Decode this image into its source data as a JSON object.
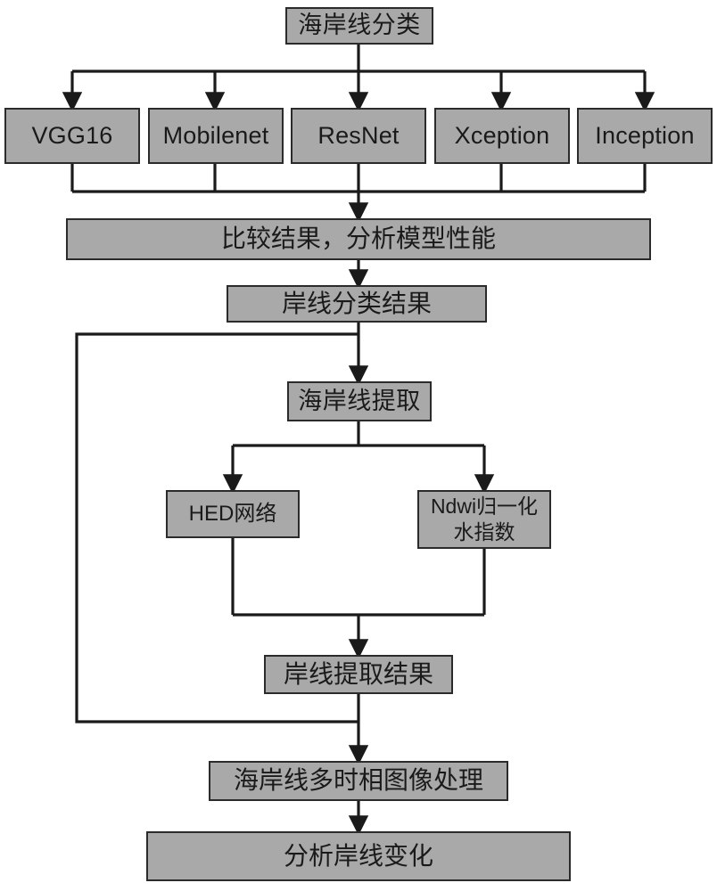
{
  "diagram": {
    "title_text": "海岸线分类",
    "background_color": "#ffffff",
    "node_fill_color": "#a9a9a9",
    "node_border_color": "#2b2b2b",
    "edge_color": "#1a1a1a",
    "nodes": {
      "coastline_classification": "海岸线分类",
      "vgg16": "VGG16",
      "mobilenet": "Mobilenet",
      "resnet": "ResNet",
      "xception": "Xception",
      "inception": "Inception",
      "compare_results": "比较结果，分析模型性能",
      "classification_result": "岸线分类结果",
      "coastline_extraction": "海岸线提取",
      "hed_network": "HED网络",
      "ndwi_index": "Ndwi归一化\n水指数",
      "extraction_result": "岸线提取结果",
      "multitemporal_processing": "海岸线多时相图像处理",
      "analyze_change": "分析岸线变化"
    }
  }
}
